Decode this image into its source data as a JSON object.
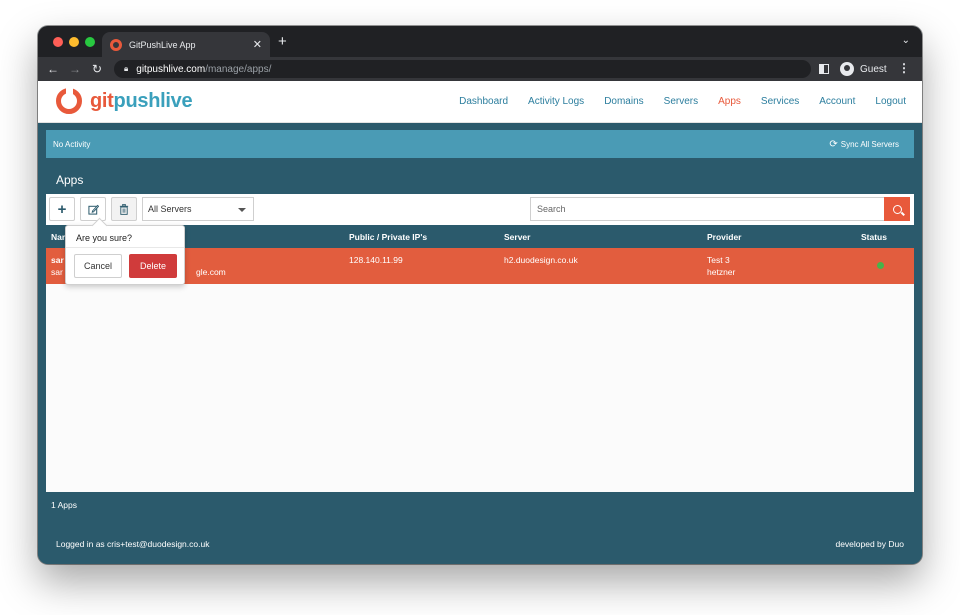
{
  "browser": {
    "tab_title": "GitPushLive App",
    "url_host": "gitpushlive.com",
    "url_path": "/manage/apps/",
    "profile_label": "Guest"
  },
  "brand": {
    "git": "git",
    "push": "pushlive"
  },
  "nav": {
    "items": [
      {
        "label": "Dashboard"
      },
      {
        "label": "Activity Logs"
      },
      {
        "label": "Domains"
      },
      {
        "label": "Servers"
      },
      {
        "label": "Apps"
      },
      {
        "label": "Services"
      },
      {
        "label": "Account"
      },
      {
        "label": "Logout"
      }
    ],
    "active": "Apps"
  },
  "activity": {
    "text": "No Activity",
    "sync_label": "Sync All Servers"
  },
  "panel": {
    "title": "Apps",
    "server_filter": "All Servers",
    "search_placeholder": "Search",
    "columns": [
      "Nar",
      "Public / Private IP's",
      "Server",
      "Provider",
      "Status"
    ],
    "rows": [
      {
        "name": "sar",
        "email_prefix": "sar",
        "email_suffix": "gle.com",
        "ip": "128.140.11.99",
        "server": "h2.duodesign.co.uk",
        "provider_name": "Test 3",
        "provider_host": "hetzner",
        "status": "online"
      }
    ],
    "footer": "1 Apps"
  },
  "popover": {
    "title": "Are you sure?",
    "cancel": "Cancel",
    "delete": "Delete"
  },
  "footer": {
    "logged_in": "Logged in as cris+test@duodesign.co.uk",
    "credit": "developed by Duo"
  },
  "colors": {
    "accent": "#e8593b",
    "primary": "#2b5a6c",
    "link": "#2c7e9e",
    "activity": "#4a9bb5",
    "row_highlight": "#e25d3e",
    "status_online": "#47b34a",
    "danger": "#d03b3b"
  }
}
